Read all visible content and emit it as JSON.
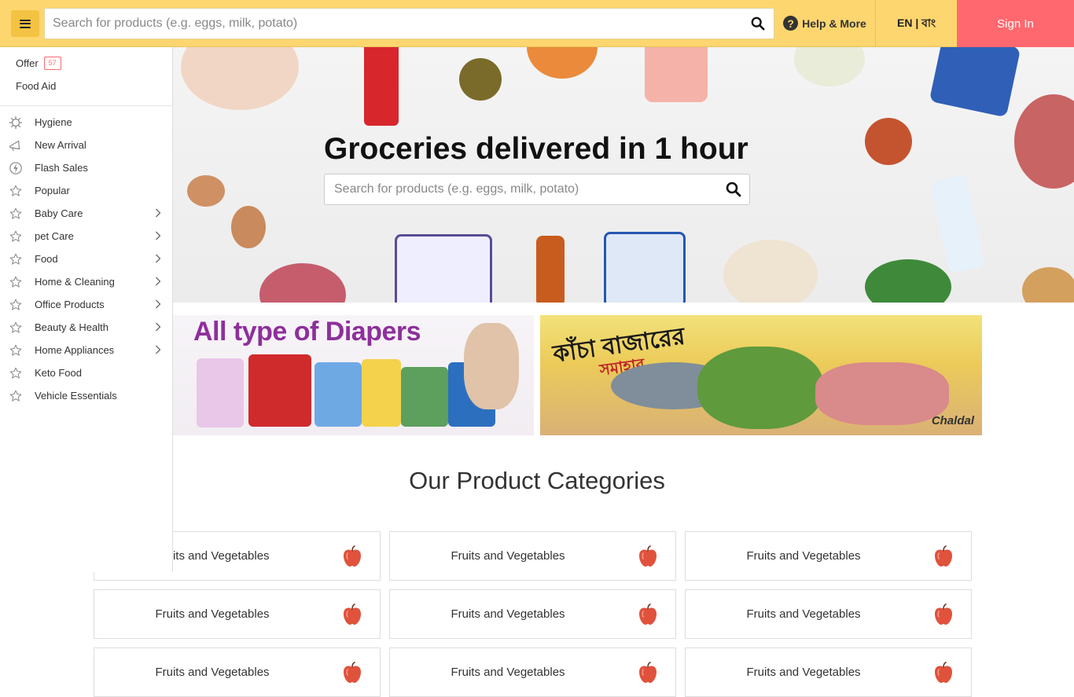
{
  "header": {
    "search_placeholder": "Search for products (e.g. eggs, milk, potato)",
    "help_label": "Help & More",
    "help_icon": "?",
    "lang_label": "EN | বাং",
    "signin_label": "Sign In"
  },
  "sidebar": {
    "top": [
      {
        "label": "Offer",
        "badge": "57"
      },
      {
        "label": "Food Aid"
      }
    ],
    "items": [
      {
        "label": "Hygiene",
        "icon": "virus-icon",
        "chevron": false
      },
      {
        "label": "New Arrival",
        "icon": "megaphone-icon",
        "chevron": false
      },
      {
        "label": "Flash Sales",
        "icon": "flash-icon",
        "chevron": false
      },
      {
        "label": "Popular",
        "icon": "star-icon",
        "chevron": false
      },
      {
        "label": "Baby Care",
        "icon": "star-icon",
        "chevron": true
      },
      {
        "label": "pet Care",
        "icon": "star-icon",
        "chevron": true
      },
      {
        "label": "Food",
        "icon": "star-icon",
        "chevron": true
      },
      {
        "label": "Home & Cleaning",
        "icon": "star-icon",
        "chevron": true
      },
      {
        "label": "Office Products",
        "icon": "star-icon",
        "chevron": true
      },
      {
        "label": "Beauty & Health",
        "icon": "star-icon",
        "chevron": true
      },
      {
        "label": "Home Appliances",
        "icon": "star-icon",
        "chevron": true
      },
      {
        "label": "Keto Food",
        "icon": "star-icon",
        "chevron": false
      },
      {
        "label": "Vehicle Essentials",
        "icon": "star-icon",
        "chevron": false
      }
    ]
  },
  "hero": {
    "title": "Groceries delivered in 1 hour",
    "search_placeholder": "Search for products (e.g. eggs, milk, potato)"
  },
  "banners": {
    "diapers_title": "All type of Diapers",
    "bazar_title_line1": "কাঁচা বাজারের",
    "bazar_title_line2": "সমাহার",
    "bazar_brand": "Chaldal"
  },
  "categories": {
    "title": "Our Product Categories",
    "cards": [
      {
        "label": "Fruits and Vegetables"
      },
      {
        "label": "Fruits and Vegetables"
      },
      {
        "label": "Fruits and Vegetables"
      },
      {
        "label": "Fruits and Vegetables"
      },
      {
        "label": "Fruits and Vegetables"
      },
      {
        "label": "Fruits and Vegetables"
      },
      {
        "label": "Fruits and Vegetables"
      },
      {
        "label": "Fruits and Vegetables"
      },
      {
        "label": "Fruits and Vegetables"
      }
    ]
  },
  "colors": {
    "header_bg": "#fdd670",
    "signin_bg": "#ff686e",
    "apple": "#e0523c",
    "diapers_title": "#8e2f9c"
  }
}
